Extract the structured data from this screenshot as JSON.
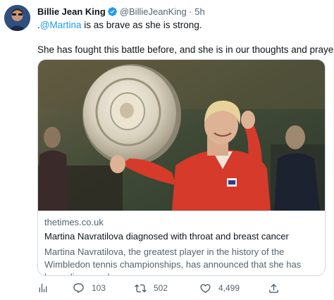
{
  "author": {
    "name": "Billie Jean King",
    "handle": "@BillieJeanKing",
    "separator": "·",
    "time": "5h"
  },
  "tweet": {
    "line1_prefix": ".",
    "mention": "@Martina",
    "line1_rest": " is as brave as she is strong.",
    "line2": "She has fought this battle before, and she is in our thoughts and prayers."
  },
  "card": {
    "domain": "thetimes.co.uk",
    "title": "Martina Navratilova diagnosed with throat and breast cancer",
    "description": "Martina Navratilova, the greatest player in the history of the Wimbledon tennis championships, has announced that she has been diagnosed ..."
  },
  "actions": {
    "views_icon": "analytics-icon",
    "reply_icon": "reply-icon",
    "reply_count": "103",
    "retweet_icon": "retweet-icon",
    "retweet_count": "502",
    "like_icon": "heart-icon",
    "like_count": "4,499",
    "share_icon": "share-icon"
  },
  "colors": {
    "link": "#1d9bf0",
    "secondary_text": "#536471",
    "verified": "#1d9bf0",
    "border": "#cfd9de"
  }
}
